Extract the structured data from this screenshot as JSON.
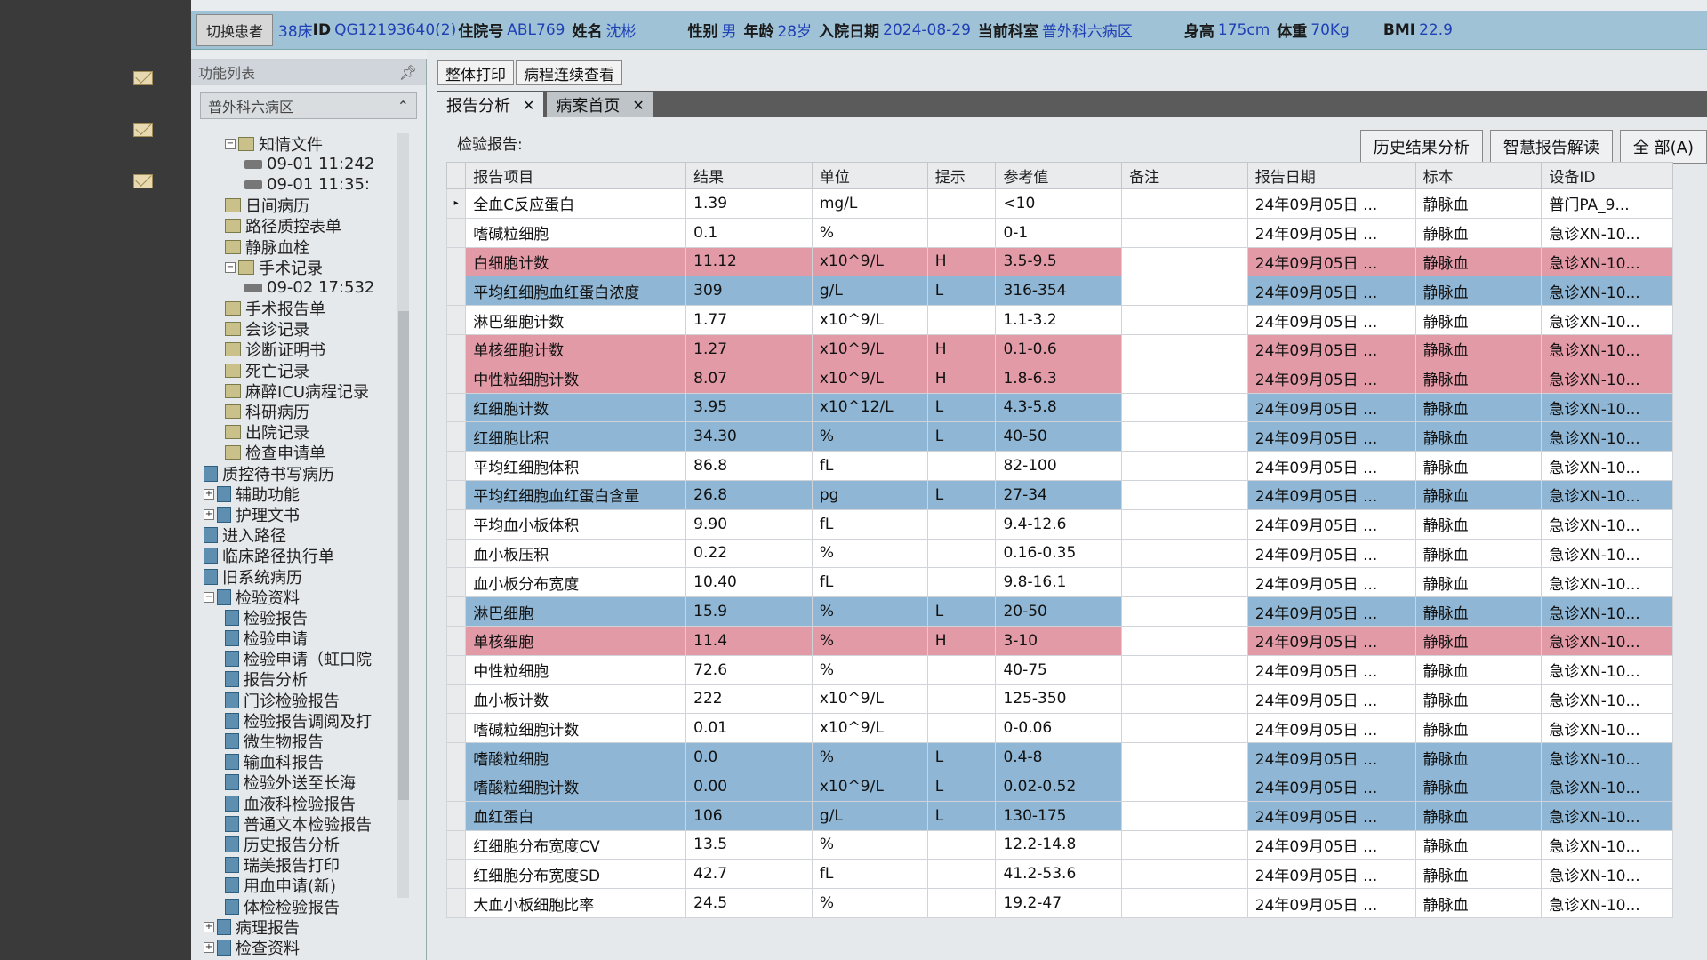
{
  "patient_bar": {
    "switch_button": "切换患者",
    "bed": "38床",
    "id_label": "ID",
    "id_value": "QG12193640(2)",
    "admission_label": "住院号",
    "admission_value": "ABL769",
    "name_label": "姓名",
    "name_value": "沈彬",
    "gender_label": "性别",
    "gender_value": "男",
    "age_label": "年龄",
    "age_value": "28岁",
    "admit_date_label": "入院日期",
    "admit_date_value": "2024-08-29",
    "dept_label": "当前科室",
    "dept_value": "普外科六病区",
    "height_label": "身高",
    "height_value": "175cm",
    "weight_label": "体重",
    "weight_value": "70Kg",
    "bmi_label": "BMI",
    "bmi_value": "22.9"
  },
  "func_panel": {
    "title": "功能列表",
    "pin_icon": "pin-icon",
    "ward": "普外科六病区",
    "tree": [
      {
        "label": "知情文件",
        "level": 2,
        "icon": "folder",
        "expander": "−"
      },
      {
        "label": "09-01 11:242",
        "level": 3,
        "icon": "pen"
      },
      {
        "label": "09-01 11:35:",
        "level": 3,
        "icon": "pen"
      },
      {
        "label": "日间病历",
        "level": 2,
        "icon": "folder"
      },
      {
        "label": "路径质控表单",
        "level": 2,
        "icon": "folder"
      },
      {
        "label": "静脉血栓",
        "level": 2,
        "icon": "folder"
      },
      {
        "label": "手术记录",
        "level": 2,
        "icon": "folder",
        "expander": "−"
      },
      {
        "label": "09-02 17:532",
        "level": 3,
        "icon": "pen"
      },
      {
        "label": "手术报告单",
        "level": 2,
        "icon": "folder"
      },
      {
        "label": "会诊记录",
        "level": 2,
        "icon": "folder"
      },
      {
        "label": "诊断证明书",
        "level": 2,
        "icon": "folder"
      },
      {
        "label": "死亡记录",
        "level": 2,
        "icon": "folder"
      },
      {
        "label": "麻醉ICU病程记录",
        "level": 2,
        "icon": "folder"
      },
      {
        "label": "科研病历",
        "level": 2,
        "icon": "folder"
      },
      {
        "label": "出院记录",
        "level": 2,
        "icon": "folder"
      },
      {
        "label": "检查申请单",
        "level": 2,
        "icon": "folder"
      },
      {
        "label": "质控待书写病历",
        "level": 1,
        "icon": "doc"
      },
      {
        "label": "辅助功能",
        "level": 1,
        "icon": "doc",
        "expander": "+"
      },
      {
        "label": "护理文书",
        "level": 1,
        "icon": "doc",
        "expander": "+"
      },
      {
        "label": "进入路径",
        "level": 1,
        "icon": "doc"
      },
      {
        "label": "临床路径执行单",
        "level": 1,
        "icon": "doc"
      },
      {
        "label": "旧系统病历",
        "level": 1,
        "icon": "doc"
      },
      {
        "label": "检验资料",
        "level": 1,
        "icon": "doc",
        "expander": "−"
      },
      {
        "label": "检验报告",
        "level": 2,
        "icon": "doc"
      },
      {
        "label": "检验申请",
        "level": 2,
        "icon": "doc"
      },
      {
        "label": "检验申请（虹口院",
        "level": 2,
        "icon": "doc"
      },
      {
        "label": "报告分析",
        "level": 2,
        "icon": "doc"
      },
      {
        "label": "门诊检验报告",
        "level": 2,
        "icon": "doc"
      },
      {
        "label": "检验报告调阅及打",
        "level": 2,
        "icon": "doc"
      },
      {
        "label": "微生物报告",
        "level": 2,
        "icon": "doc"
      },
      {
        "label": "输血科报告",
        "level": 2,
        "icon": "doc"
      },
      {
        "label": "检验外送至长海",
        "level": 2,
        "icon": "doc"
      },
      {
        "label": "血液科检验报告",
        "level": 2,
        "icon": "doc"
      },
      {
        "label": "普通文本检验报告",
        "level": 2,
        "icon": "doc"
      },
      {
        "label": "历史报告分析",
        "level": 2,
        "icon": "doc"
      },
      {
        "label": "瑞美报告打印",
        "level": 2,
        "icon": "doc"
      },
      {
        "label": "用血申请(新)",
        "level": 2,
        "icon": "doc"
      },
      {
        "label": "体检检验报告",
        "level": 2,
        "icon": "doc"
      },
      {
        "label": "病理报告",
        "level": 1,
        "icon": "doc",
        "expander": "+"
      },
      {
        "label": "检查资料",
        "level": 1,
        "icon": "doc",
        "expander": "+"
      }
    ]
  },
  "top_tabs": [
    "整体打印",
    "病程连续查看"
  ],
  "doc_tabs": [
    {
      "label": "报告分析",
      "active": true
    },
    {
      "label": "病案首页",
      "active": false
    }
  ],
  "report_label": "检验报告:",
  "action_buttons": [
    "历史结果分析",
    "智慧报告解读",
    "全  部(A)"
  ],
  "table": {
    "columns": [
      "报告项目",
      "结果",
      "单位",
      "提示",
      "参考值",
      "备注",
      "报告日期",
      "标本",
      "设备ID"
    ],
    "rows": [
      {
        "item": "全血C反应蛋白",
        "result": "1.39",
        "unit": "mg/L",
        "flag": "",
        "ref": "<10",
        "note": "",
        "date": "24年09月05日 ...",
        "specimen": "静脉血",
        "device": "普门PA_9...",
        "selected": true
      },
      {
        "item": "嗜碱粒细胞",
        "result": "0.1",
        "unit": "%",
        "flag": "",
        "ref": "0-1",
        "note": "",
        "date": "24年09月05日 ...",
        "specimen": "静脉血",
        "device": "急诊XN-10..."
      },
      {
        "item": "白细胞计数",
        "result": "11.12",
        "unit": "x10^9/L",
        "flag": "H",
        "ref": "3.5-9.5",
        "note": "",
        "date": "24年09月05日 ...",
        "specimen": "静脉血",
        "device": "急诊XN-10..."
      },
      {
        "item": "平均红细胞血红蛋白浓度",
        "result": "309",
        "unit": "g/L",
        "flag": "L",
        "ref": "316-354",
        "note": "",
        "date": "24年09月05日 ...",
        "specimen": "静脉血",
        "device": "急诊XN-10..."
      },
      {
        "item": "淋巴细胞计数",
        "result": "1.77",
        "unit": "x10^9/L",
        "flag": "",
        "ref": "1.1-3.2",
        "note": "",
        "date": "24年09月05日 ...",
        "specimen": "静脉血",
        "device": "急诊XN-10..."
      },
      {
        "item": "单核细胞计数",
        "result": "1.27",
        "unit": "x10^9/L",
        "flag": "H",
        "ref": "0.1-0.6",
        "note": "",
        "date": "24年09月05日 ...",
        "specimen": "静脉血",
        "device": "急诊XN-10..."
      },
      {
        "item": "中性粒细胞计数",
        "result": "8.07",
        "unit": "x10^9/L",
        "flag": "H",
        "ref": "1.8-6.3",
        "note": "",
        "date": "24年09月05日 ...",
        "specimen": "静脉血",
        "device": "急诊XN-10..."
      },
      {
        "item": "红细胞计数",
        "result": "3.95",
        "unit": "x10^12/L",
        "flag": "L",
        "ref": "4.3-5.8",
        "note": "",
        "date": "24年09月05日 ...",
        "specimen": "静脉血",
        "device": "急诊XN-10..."
      },
      {
        "item": "红细胞比积",
        "result": "34.30",
        "unit": "%",
        "flag": "L",
        "ref": "40-50",
        "note": "",
        "date": "24年09月05日 ...",
        "specimen": "静脉血",
        "device": "急诊XN-10..."
      },
      {
        "item": "平均红细胞体积",
        "result": "86.8",
        "unit": "fL",
        "flag": "",
        "ref": "82-100",
        "note": "",
        "date": "24年09月05日 ...",
        "specimen": "静脉血",
        "device": "急诊XN-10..."
      },
      {
        "item": "平均红细胞血红蛋白含量",
        "result": "26.8",
        "unit": "pg",
        "flag": "L",
        "ref": "27-34",
        "note": "",
        "date": "24年09月05日 ...",
        "specimen": "静脉血",
        "device": "急诊XN-10..."
      },
      {
        "item": "平均血小板体积",
        "result": "9.90",
        "unit": "fL",
        "flag": "",
        "ref": "9.4-12.6",
        "note": "",
        "date": "24年09月05日 ...",
        "specimen": "静脉血",
        "device": "急诊XN-10..."
      },
      {
        "item": "血小板压积",
        "result": "0.22",
        "unit": "%",
        "flag": "",
        "ref": "0.16-0.35",
        "note": "",
        "date": "24年09月05日 ...",
        "specimen": "静脉血",
        "device": "急诊XN-10..."
      },
      {
        "item": "血小板分布宽度",
        "result": "10.40",
        "unit": "fL",
        "flag": "",
        "ref": "9.8-16.1",
        "note": "",
        "date": "24年09月05日 ...",
        "specimen": "静脉血",
        "device": "急诊XN-10..."
      },
      {
        "item": "淋巴细胞",
        "result": "15.9",
        "unit": "%",
        "flag": "L",
        "ref": "20-50",
        "note": "",
        "date": "24年09月05日 ...",
        "specimen": "静脉血",
        "device": "急诊XN-10..."
      },
      {
        "item": "单核细胞",
        "result": "11.4",
        "unit": "%",
        "flag": "H",
        "ref": "3-10",
        "note": "",
        "date": "24年09月05日 ...",
        "specimen": "静脉血",
        "device": "急诊XN-10..."
      },
      {
        "item": "中性粒细胞",
        "result": "72.6",
        "unit": "%",
        "flag": "",
        "ref": "40-75",
        "note": "",
        "date": "24年09月05日 ...",
        "specimen": "静脉血",
        "device": "急诊XN-10..."
      },
      {
        "item": "血小板计数",
        "result": "222",
        "unit": "x10^9/L",
        "flag": "",
        "ref": "125-350",
        "note": "",
        "date": "24年09月05日 ...",
        "specimen": "静脉血",
        "device": "急诊XN-10..."
      },
      {
        "item": "嗜碱粒细胞计数",
        "result": "0.01",
        "unit": "x10^9/L",
        "flag": "",
        "ref": "0-0.06",
        "note": "",
        "date": "24年09月05日 ...",
        "specimen": "静脉血",
        "device": "急诊XN-10..."
      },
      {
        "item": "嗜酸粒细胞",
        "result": "0.0",
        "unit": "%",
        "flag": "L",
        "ref": "0.4-8",
        "note": "",
        "date": "24年09月05日 ...",
        "specimen": "静脉血",
        "device": "急诊XN-10..."
      },
      {
        "item": "嗜酸粒细胞计数",
        "result": "0.00",
        "unit": "x10^9/L",
        "flag": "L",
        "ref": "0.02-0.52",
        "note": "",
        "date": "24年09月05日 ...",
        "specimen": "静脉血",
        "device": "急诊XN-10..."
      },
      {
        "item": "血红蛋白",
        "result": "106",
        "unit": "g/L",
        "flag": "L",
        "ref": "130-175",
        "note": "",
        "date": "24年09月05日 ...",
        "specimen": "静脉血",
        "device": "急诊XN-10..."
      },
      {
        "item": "红细胞分布宽度CV",
        "result": "13.5",
        "unit": "%",
        "flag": "",
        "ref": "12.2-14.8",
        "note": "",
        "date": "24年09月05日 ...",
        "specimen": "静脉血",
        "device": "急诊XN-10..."
      },
      {
        "item": "红细胞分布宽度SD",
        "result": "42.7",
        "unit": "fL",
        "flag": "",
        "ref": "41.2-53.6",
        "note": "",
        "date": "24年09月05日 ...",
        "specimen": "静脉血",
        "device": "急诊XN-10..."
      },
      {
        "item": "大血小板细胞比率",
        "result": "24.5",
        "unit": "%",
        "flag": "",
        "ref": "19.2-47",
        "note": "",
        "date": "24年09月05日 ...",
        "specimen": "静脉血",
        "device": "急诊XN-10..."
      }
    ]
  },
  "colors": {
    "high": "#e39aa7",
    "low": "#8fb6d4",
    "patient_bar": "#9fc2d6",
    "value_text": "#1f3fb5"
  }
}
